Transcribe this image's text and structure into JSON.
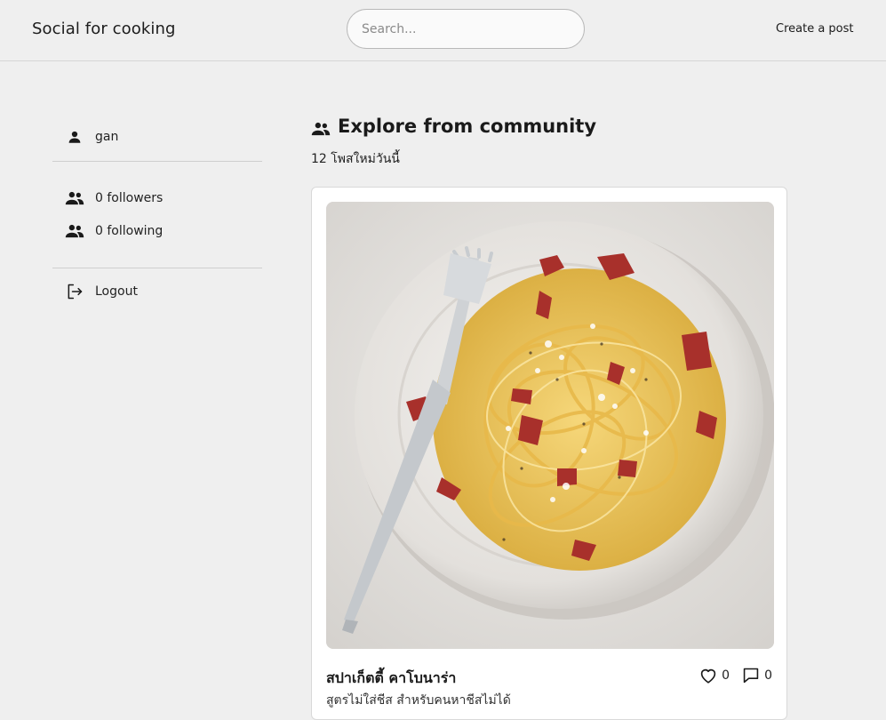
{
  "header": {
    "brand": "Social for cooking",
    "search_placeholder": "Search...",
    "create_post_label": "Create a post"
  },
  "sidebar": {
    "username": "gan",
    "followers": "0 followers",
    "following": "0 following",
    "logout": "Logout"
  },
  "feed": {
    "title": "Explore from community",
    "subtitle": "12 โพสใหม่วันนี้"
  },
  "post": {
    "title": "สปาเก็ตตี้ คาโบนาร่า",
    "description": "สูตรไม่ใส่ชีส สำหรับคนหาชีสไม่ได้",
    "likes": "0",
    "comments": "0",
    "image_alt": "spaghetti carbonara on a plate"
  }
}
